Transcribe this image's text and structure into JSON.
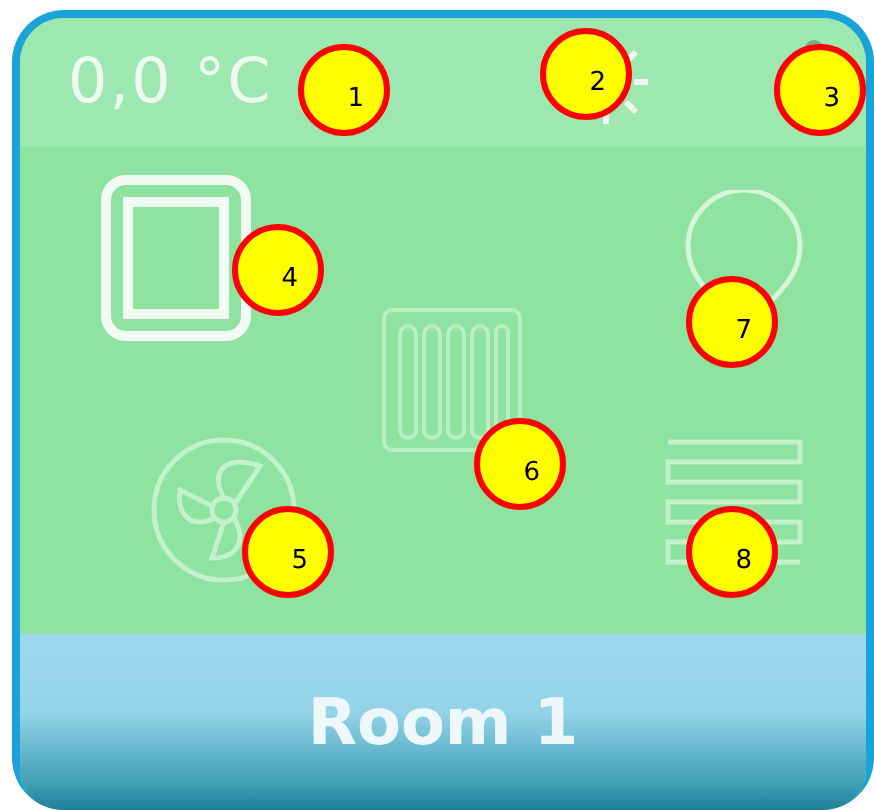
{
  "tile": {
    "temperature": "0,0 °C",
    "room_name": "Room 1"
  },
  "callouts": [
    {
      "label": "1"
    },
    {
      "label": "2"
    },
    {
      "label": "3"
    },
    {
      "label": "4"
    },
    {
      "label": "5"
    },
    {
      "label": "6"
    },
    {
      "label": "7"
    },
    {
      "label": "8"
    }
  ]
}
